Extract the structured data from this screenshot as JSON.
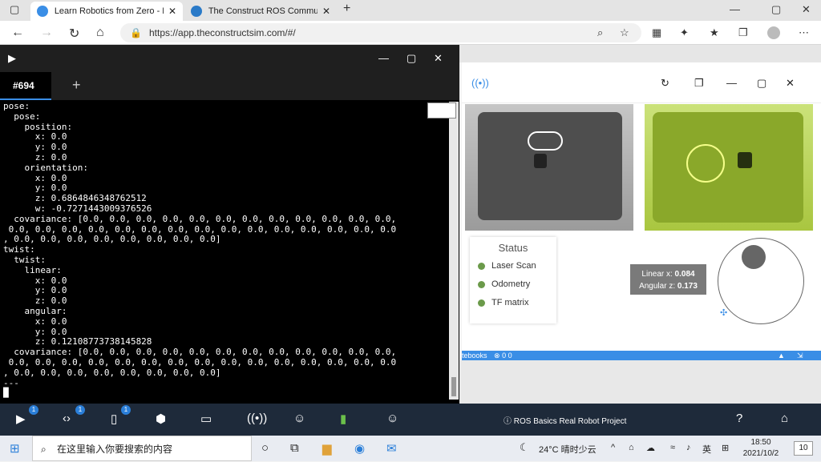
{
  "browser": {
    "tabs": [
      {
        "title": "Learn Robotics from Zero - Robo",
        "active": true
      },
      {
        "title": "The Construct ROS Community",
        "active": false
      }
    ],
    "url": "https://app.theconstructsim.com/#/"
  },
  "terminal": {
    "tab_label": "#694",
    "lines": [
      "pose:",
      "  pose:",
      "    position:",
      "      x: 0.0",
      "      y: 0.0",
      "      z: 0.0",
      "    orientation:",
      "      x: 0.0",
      "      y: 0.0",
      "      z: 0.6864846348762512",
      "      w: -0.7271443009376526",
      "  covariance: [0.0, 0.0, 0.0, 0.0, 0.0, 0.0, 0.0, 0.0, 0.0, 0.0, 0.0, 0.0,",
      " 0.0, 0.0, 0.0, 0.0, 0.0, 0.0, 0.0, 0.0, 0.0, 0.0, 0.0, 0.0, 0.0, 0.0, 0.0",
      ", 0.0, 0.0, 0.0, 0.0, 0.0, 0.0, 0.0, 0.0]",
      "twist:",
      "  twist:",
      "    linear:",
      "      x: 0.0",
      "      y: 0.0",
      "      z: 0.0",
      "    angular:",
      "      x: 0.0",
      "      y: 0.0",
      "      z: 0.12108773738145828",
      "  covariance: [0.0, 0.0, 0.0, 0.0, 0.0, 0.0, 0.0, 0.0, 0.0, 0.0, 0.0, 0.0,",
      " 0.0, 0.0, 0.0, 0.0, 0.0, 0.0, 0.0, 0.0, 0.0, 0.0, 0.0, 0.0, 0.0, 0.0, 0.0",
      ", 0.0, 0.0, 0.0, 0.0, 0.0, 0.0, 0.0, 0.0]",
      "---",
      ""
    ]
  },
  "robot_panel": {
    "status_title": "Status",
    "status_items": [
      "Laser Scan",
      "Odometry",
      "TF matrix"
    ],
    "velocity": {
      "linear_label": "Linear x:",
      "linear_value": "0.084",
      "angular_label": "Angular z:",
      "angular_value": "0.173"
    },
    "bottom_bar_text": "tebooks",
    "bottom_bar_counts": "0  0"
  },
  "app_bar": {
    "badges": [
      "1",
      "1",
      "1"
    ],
    "project_title": "ROS Basics Real Robot Project"
  },
  "taskbar": {
    "search_placeholder": "在这里输入你要搜索的内容",
    "weather": "24°C 晴时少云",
    "ime": "英",
    "time": "18:50",
    "date": "2021/10/2",
    "notif_count": "10"
  },
  "colors": {
    "accent": "#3a8ee6",
    "status_ok": "#6b9a4a",
    "appbar": "#1e2a3a"
  }
}
